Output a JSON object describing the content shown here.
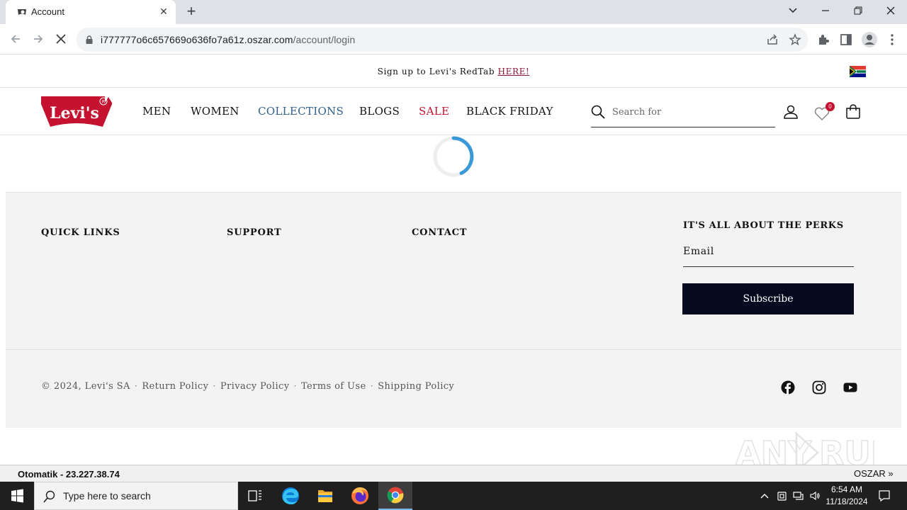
{
  "browser": {
    "tab_title": "Account",
    "url_host": "i777777o6c657669o636fo7a61z.oszar.com",
    "url_path": "/account/login",
    "icons": [
      "favicon",
      "close-icon",
      "new-tab-icon",
      "back-icon",
      "forward-icon",
      "stop-icon",
      "lock-icon",
      "share-icon",
      "star-icon",
      "extensions-icon",
      "side-panel-icon",
      "profile-icon",
      "menu-icon"
    ]
  },
  "announcement": {
    "text": "Sign up to Levi's RedTab ",
    "link": "HERE!",
    "link_color": "#8a1538"
  },
  "header": {
    "logo_text": "Levi's",
    "nav": [
      {
        "label": "MEN",
        "color": "#121212"
      },
      {
        "label": "WOMEN",
        "color": "#121212"
      },
      {
        "label": "COLLECTIONS",
        "color": "#2f5f8a"
      },
      {
        "label": "BLOGS",
        "color": "#121212"
      },
      {
        "label": "SALE",
        "color": "#c41230"
      },
      {
        "label": "BLACK FRIDAY",
        "color": "#121212"
      }
    ],
    "search_placeholder": "Search for",
    "wishlist_count": "0"
  },
  "footer": {
    "quick_links": "QUICK LINKS",
    "support": "SUPPORT",
    "contact": "CONTACT",
    "perks_title": "IT'S ALL ABOUT THE PERKS",
    "email_placeholder": "Email",
    "subscribe_label": "Subscribe",
    "copyright": "© 2024, Levi's SA",
    "legal_links": [
      "Return Policy",
      "Privacy Policy",
      "Terms of Use",
      "Shipping Policy"
    ],
    "social": [
      "facebook-icon",
      "instagram-icon",
      "youtube-icon"
    ]
  },
  "statusbar": {
    "left": "Otomatik - 23.227.38.74",
    "right": "OSZAR »"
  },
  "taskbar": {
    "search_text": "Type here to search",
    "time": "6:54 AM",
    "date": "11/18/2024"
  },
  "watermark": "ANY RUN"
}
